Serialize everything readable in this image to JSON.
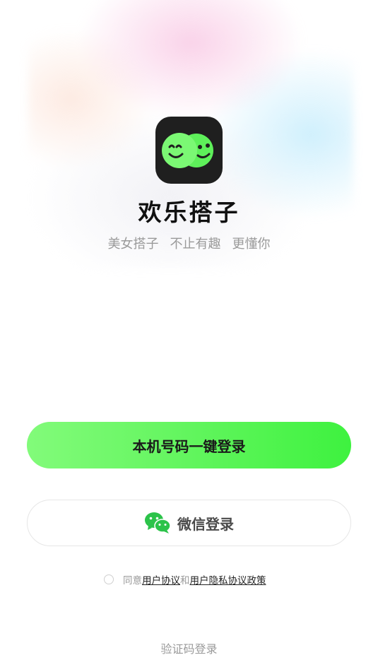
{
  "app": {
    "name": "欢乐搭子",
    "slogan": [
      "美女搭子",
      "不止有趣",
      "更懂你"
    ]
  },
  "login": {
    "phone_button_label": "本机号码一键登录",
    "wechat_button_label": "微信登录",
    "code_login_label": "验证码登录"
  },
  "agreement": {
    "prefix": "同意",
    "user_agreement": "用户协议",
    "conjunction": "和",
    "privacy_policy": "用户隐私协议政策",
    "checked": false
  },
  "colors": {
    "accent_green": "#4cf04a",
    "logo_bg": "#1f1f1f",
    "wechat_green": "#2cc34a"
  }
}
